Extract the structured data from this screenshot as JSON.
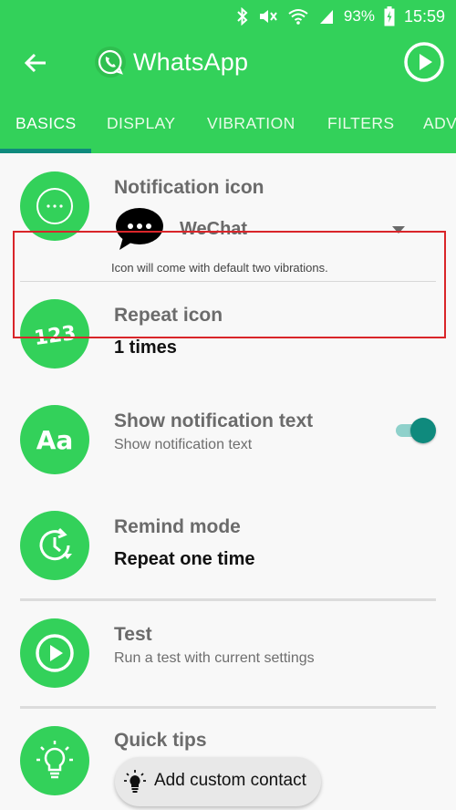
{
  "status_bar": {
    "battery_percent": "93%",
    "time": "15:59"
  },
  "app_bar": {
    "title": "WhatsApp",
    "back_icon": "arrow-left-icon",
    "play_icon": "play-circle-icon"
  },
  "tabs": [
    {
      "label": "BASICS",
      "active": true
    },
    {
      "label": "DISPLAY",
      "active": false
    },
    {
      "label": "VIBRATION",
      "active": false
    },
    {
      "label": "FILTERS",
      "active": false
    },
    {
      "label": "ADV",
      "active": false
    }
  ],
  "items": {
    "notification_icon": {
      "title": "Notification icon",
      "selected": "WeChat",
      "hint": "Icon will come with default two vibrations."
    },
    "repeat_icon": {
      "title": "Repeat icon",
      "value": "1 times",
      "icon_text": "123"
    },
    "show_text": {
      "title": "Show notification text",
      "subtitle": "Show notification text",
      "icon_text": "Aa",
      "enabled": true
    },
    "remind_mode": {
      "title": "Remind mode",
      "value": "Repeat one time"
    },
    "test": {
      "title": "Test",
      "subtitle": "Run a test with current settings"
    },
    "quick_tips": {
      "title": "Quick tips",
      "chip_label": "Add custom contact"
    }
  },
  "colors": {
    "brand_green": "#33d15a",
    "accent_teal": "#0f8a7d",
    "highlight_red": "#d9252a"
  }
}
